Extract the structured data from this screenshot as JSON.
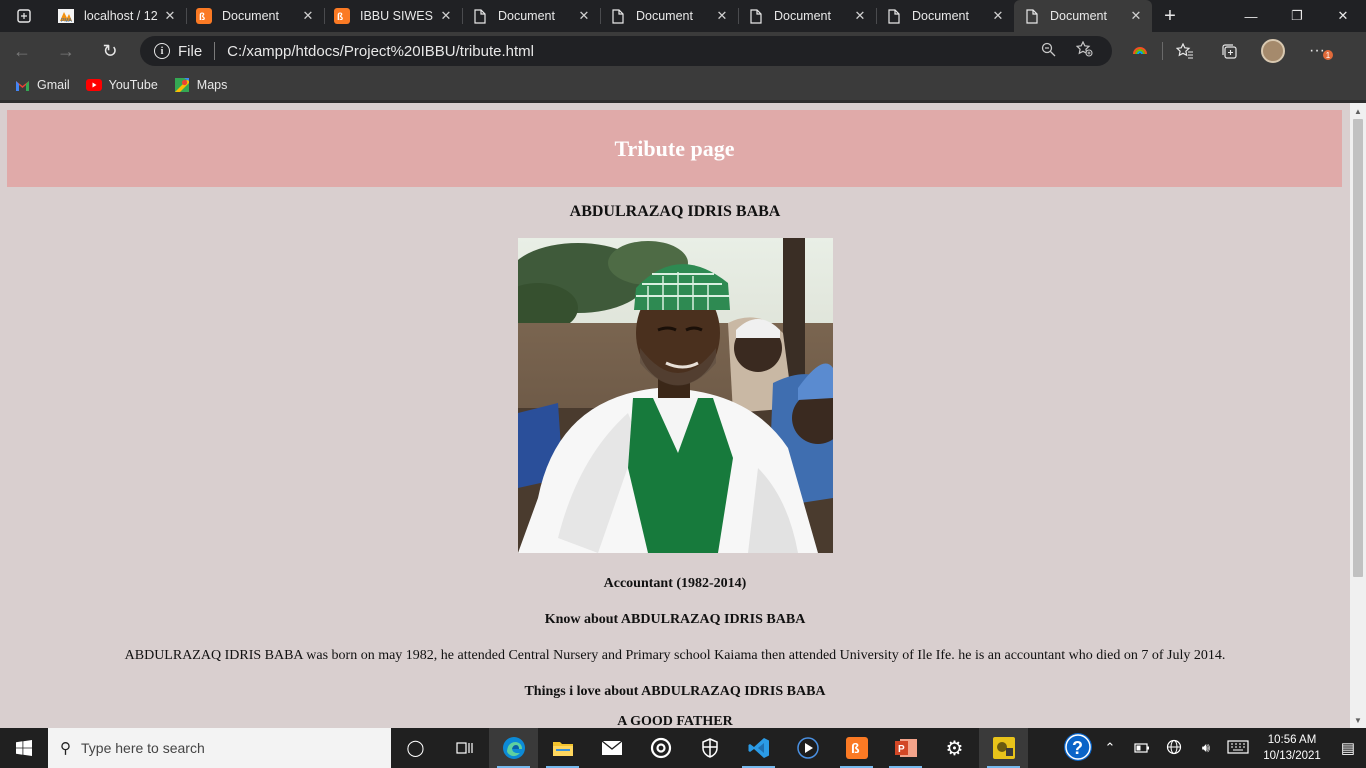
{
  "browser": {
    "tabs": [
      {
        "title": "localhost / 12",
        "favicon": "phpmyadmin-icon",
        "active": false
      },
      {
        "title": "Document",
        "favicon": "xampp-icon",
        "active": false
      },
      {
        "title": "IBBU SIWES",
        "favicon": "xampp-icon",
        "active": false
      },
      {
        "title": "Document",
        "favicon": "page-icon",
        "active": false
      },
      {
        "title": "Document",
        "favicon": "page-icon",
        "active": false
      },
      {
        "title": "Document",
        "favicon": "page-icon",
        "active": false
      },
      {
        "title": "Document",
        "favicon": "page-icon",
        "active": false
      },
      {
        "title": "Document",
        "favicon": "page-icon",
        "active": true
      }
    ],
    "address": {
      "scheme_label": "File",
      "url": "C:/xampp/htdocs/Project%20IBBU/tribute.html"
    },
    "bookmarks": [
      {
        "label": "Gmail",
        "icon": "gmail-icon"
      },
      {
        "label": "YouTube",
        "icon": "youtube-icon"
      },
      {
        "label": "Maps",
        "icon": "maps-icon"
      }
    ],
    "notification_count": "1"
  },
  "page": {
    "header_title": "Tribute page",
    "name": "ABDULRAZAQ IDRIS BABA",
    "photo_alt": "ABDULRAZAQ IDRIS BABA",
    "role": "Accountant (1982-2014)",
    "know_heading": "Know about ABDULRAZAQ IDRIS BABA",
    "bio": "ABDULRAZAQ IDRIS BABA was born on may 1982, he attended Central Nursery and Primary school Kaiama then attended University of Ile Ife. he is an accountant who died on 7 of July 2014.",
    "things_heading": "Things i love about ABDULRAZAQ IDRIS BABA",
    "partial_line": "A GOOD FATHER",
    "colors": {
      "header_bg": "#e0aaa9",
      "page_bg": "#d9cfcf",
      "header_text": "#ffffff"
    }
  },
  "taskbar": {
    "search_placeholder": "Type here to search",
    "time": "10:56 AM",
    "date": "10/13/2021"
  }
}
